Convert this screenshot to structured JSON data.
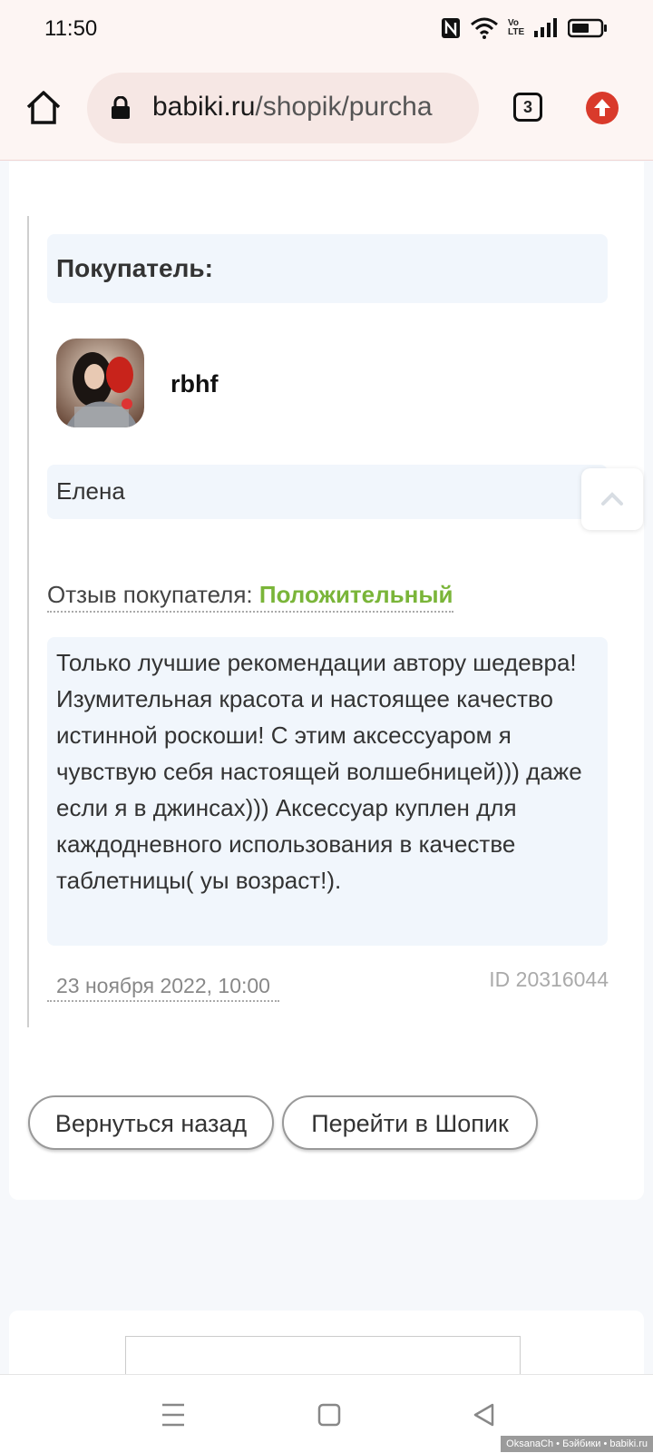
{
  "status_bar": {
    "time": "11:50",
    "icons": [
      "nfc-icon",
      "wifi-icon",
      "volte-icon",
      "signal-icon",
      "battery-icon"
    ],
    "volte_label": "Vo LTE"
  },
  "browser": {
    "url_host": "babiki.ru",
    "url_path": "/shopik/purcha",
    "tab_count": "3",
    "accent_color": "#d93a2b"
  },
  "buyer": {
    "header_label": "Покупатель:",
    "username": "rbhf",
    "name": "Елена"
  },
  "review": {
    "label": "Отзыв покупателя: ",
    "rating": "Положительный",
    "rating_color": "#7ab539",
    "text": "Только лучшие рекомендации автору шедевра! Изумительная красота и настоящее качество истинной роскоши! С этим аксессуаром я чувствую себя настоящей волшебницей))) даже если я в джинсах))) Аксессуар куплен для каждодневного использования в качестве таблетницы( уы возраст!).",
    "date": "23 ноября 2022, 10:00",
    "id": "ID 20316044"
  },
  "actions": {
    "back_label": "Вернуться назад",
    "shop_label": "Перейти в Шопик"
  },
  "watermark": "OksanaCh • Бэйбики • babiki.ru"
}
